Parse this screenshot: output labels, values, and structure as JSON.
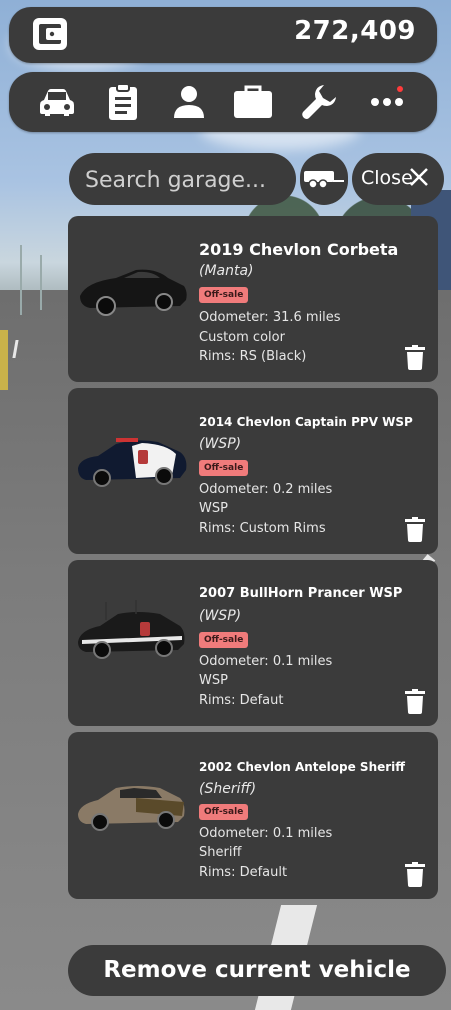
{
  "header": {
    "money": "272,409",
    "wallet_icon": "wallet-icon"
  },
  "nav": {
    "items": [
      {
        "name": "car-icon"
      },
      {
        "name": "clipboard-icon"
      },
      {
        "name": "person-icon"
      },
      {
        "name": "briefcase-icon"
      },
      {
        "name": "wrench-icon"
      },
      {
        "name": "more-icon",
        "notification": true
      }
    ],
    "notification_color": "#ff3b3b"
  },
  "search": {
    "placeholder": "Search garage..."
  },
  "close_label": "Close",
  "vehicles": [
    {
      "title": "2019 Chevlon Corbeta",
      "subtitle": "(Manta)",
      "badge": "Off-sale",
      "odometer": "Odometer: 31.6 miles",
      "extra": "Custom color",
      "rims": "Rims: RS (Black)"
    },
    {
      "title": "2014 Chevlon Captain PPV WSP",
      "subtitle": "(WSP)",
      "badge": "Off-sale",
      "odometer": "Odometer: 0.2 miles",
      "extra": "WSP",
      "rims": "Rims: Custom Rims"
    },
    {
      "title": "2007 BullHorn Prancer WSP",
      "subtitle": "(WSP)",
      "badge": "Off-sale",
      "odometer": "Odometer: 0.1 miles",
      "extra": "WSP",
      "rims": "Rims: Defaut"
    },
    {
      "title": "2002 Chevlon Antelope Sheriff",
      "subtitle": "(Sheriff)",
      "badge": "Off-sale",
      "odometer": "Odometer: 0.1 miles",
      "extra": "Sheriff",
      "rims": "Rims: Default"
    }
  ],
  "remove_label": "Remove current vehicle",
  "colors": {
    "panel": "#3b3b3b",
    "badge": "#f07b7b"
  }
}
